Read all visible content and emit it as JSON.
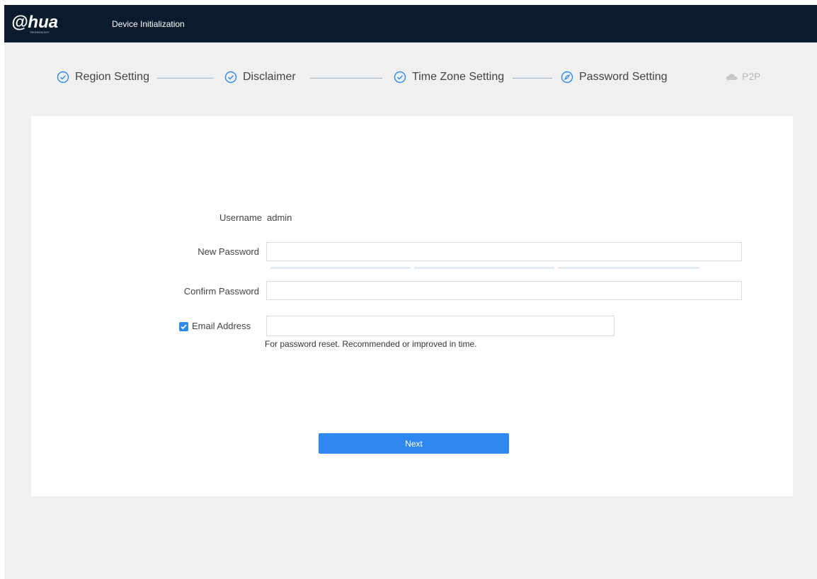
{
  "header": {
    "logo_text": "alhua",
    "logo_subtext": "TECHNOLOGY",
    "title": "Device Initialization",
    "background": "#0b1b2e"
  },
  "steps": [
    {
      "label": "Region Setting",
      "status": "completed",
      "icon": "check-circle-icon"
    },
    {
      "label": "Disclaimer",
      "status": "completed",
      "icon": "check-circle-icon"
    },
    {
      "label": "Time Zone Setting",
      "status": "completed",
      "icon": "check-circle-icon"
    },
    {
      "label": "Password Setting",
      "status": "current",
      "icon": "compass-circle-icon"
    },
    {
      "label": "P2P",
      "status": "pending",
      "icon": "cloud-icon"
    }
  ],
  "form": {
    "username_label": "Username",
    "username_value": "admin",
    "new_password_label": "New Password",
    "new_password_value": "",
    "confirm_password_label": "Confirm Password",
    "confirm_password_value": "",
    "email_checked": true,
    "email_label": "Email Address",
    "email_value": "",
    "email_hint": "For password reset. Recommended or improved in time.",
    "password_strength_segments": 3
  },
  "buttons": {
    "next_label": "Next"
  },
  "colors": {
    "accent": "#2e88f0",
    "completed_step_icon": "#2e88f0",
    "step_connector": "#9ab8dc",
    "pending_step": "#b8b8b8"
  }
}
